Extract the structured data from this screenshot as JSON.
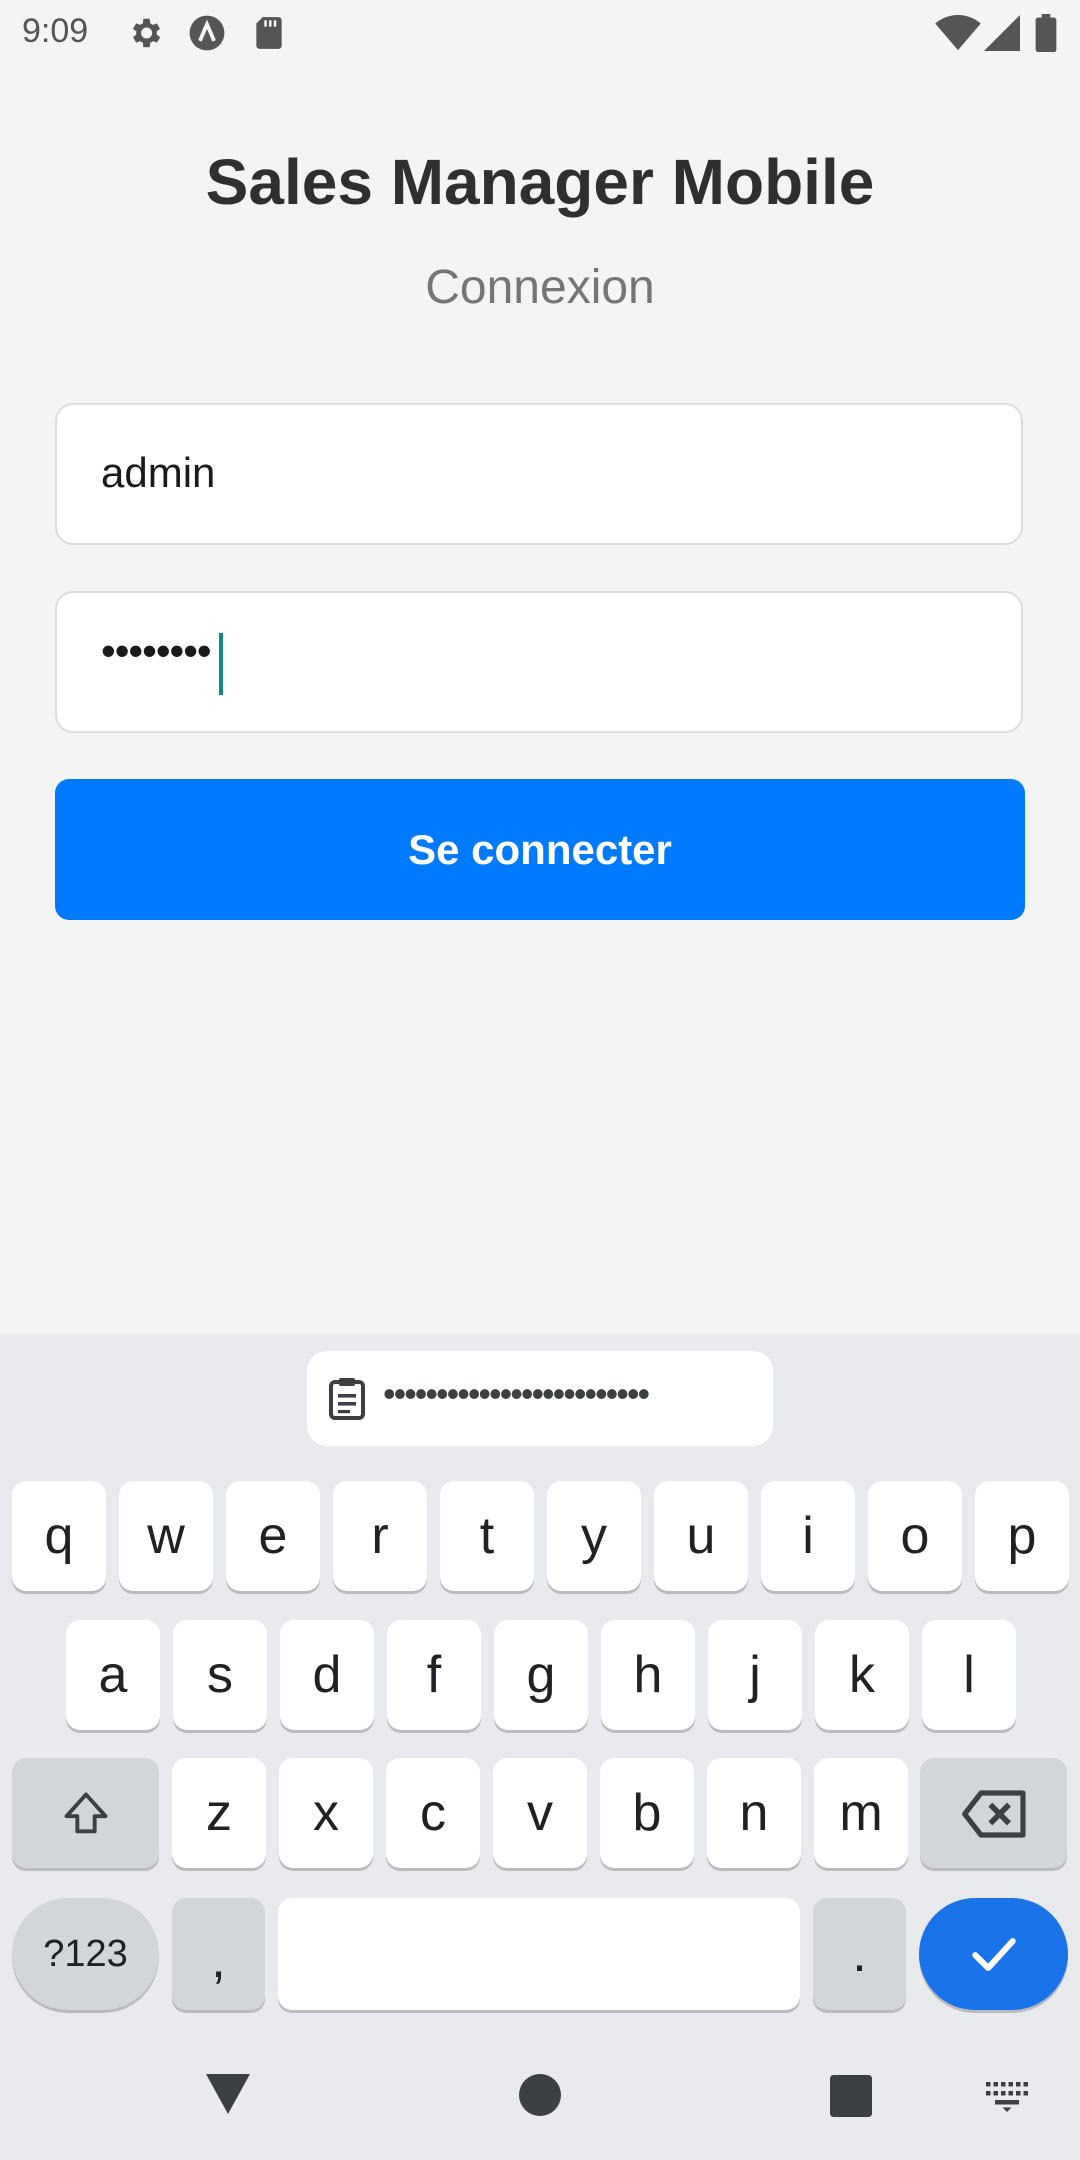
{
  "status_bar": {
    "time": "9:09",
    "left_icons": [
      "gear-icon",
      "app-a-icon",
      "sd-card-icon"
    ],
    "right_icons": [
      "wifi-icon",
      "signal-icon",
      "battery-icon"
    ]
  },
  "login": {
    "title": "Sales Manager Mobile",
    "subtitle": "Connexion",
    "username_value": "admin",
    "password_value": "••••••••",
    "button_label": "Se connecter",
    "accent_color": "#007bff",
    "caret_color": "#128c7e"
  },
  "keyboard": {
    "clipboard_preview": "•••••••••••••••••••••••••",
    "row1": [
      "q",
      "w",
      "e",
      "r",
      "t",
      "y",
      "u",
      "i",
      "o",
      "p"
    ],
    "row2": [
      "a",
      "s",
      "d",
      "f",
      "g",
      "h",
      "j",
      "k",
      "l"
    ],
    "row3": [
      "z",
      "x",
      "c",
      "v",
      "b",
      "n",
      "m"
    ],
    "symbols_key": "?123",
    "comma_key": ",",
    "period_key": ".",
    "enter_color": "#1a73e8"
  },
  "nav_bar": {
    "icons": [
      "back-icon",
      "home-icon",
      "recents-icon",
      "keyboard-switch-icon"
    ]
  }
}
